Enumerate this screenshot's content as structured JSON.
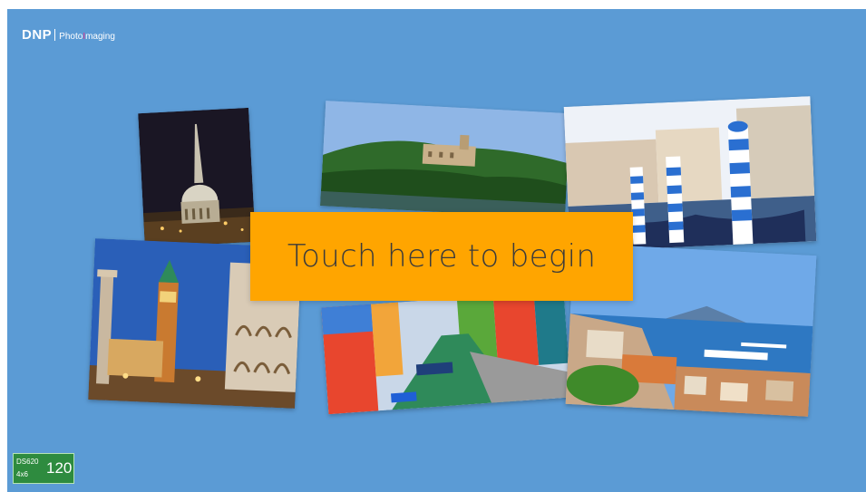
{
  "brand": {
    "name": "DNP",
    "tagline_part1": "Photo",
    "tagline_part2": "I",
    "tagline_part3": "maging"
  },
  "cta": {
    "label": "Touch here to begin"
  },
  "printer_status": {
    "model": "DS620",
    "media_size": "4x6",
    "remaining_prints": "120"
  },
  "colors": {
    "background": "#5b9bd5",
    "cta_background": "#ffa500",
    "status_background": "#2e8b3f",
    "logo_accent": "#e8318c"
  },
  "photos": [
    {
      "subject": "night-tower-dome"
    },
    {
      "subject": "hilltop-castle-lake"
    },
    {
      "subject": "venice-gondola-poles"
    },
    {
      "subject": "st-marks-campanile"
    },
    {
      "subject": "colorful-canal-houses"
    },
    {
      "subject": "bay-of-naples"
    }
  ]
}
